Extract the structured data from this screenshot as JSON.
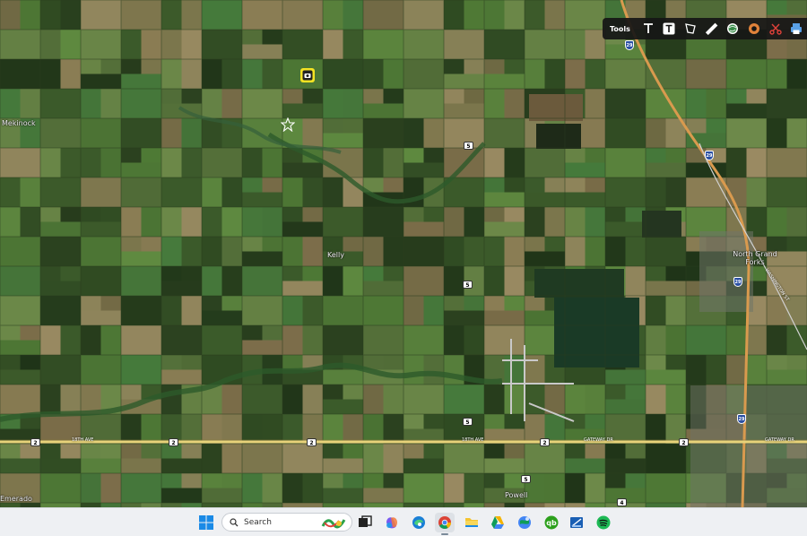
{
  "map": {
    "places": [
      "Mekinock",
      "Kelly",
      "North Grand Forks",
      "Emerado",
      "Powell"
    ],
    "road_labels": [
      "18TH AVE",
      "18TH AVE",
      "GATEWAY DR",
      "GATEWAY DR",
      "WASHINGTON ST"
    ],
    "shields": {
      "state": [
        "5",
        "5",
        "5",
        "5",
        "2",
        "2",
        "2",
        "2",
        "2"
      ],
      "interstate": [
        "29",
        "29",
        "29"
      ],
      "county": "4"
    }
  },
  "toolbar": {
    "label": "Tools",
    "tools": [
      "text-tool",
      "text-box-tool",
      "polygon-tool",
      "ruler-tool",
      "globe-tool",
      "circle-tool",
      "scissors-tool",
      "print-tool"
    ]
  },
  "taskbar": {
    "search_placeholder": "Search",
    "apps": [
      "start",
      "search",
      "task-view",
      "copilot",
      "edge",
      "chrome",
      "file-explorer",
      "google-drive",
      "google-earth",
      "quickbooks",
      "snipping-tool",
      "spotify"
    ]
  },
  "colors": {
    "field_dark": "#2f4a22",
    "field_green": "#4f7a36",
    "field_tan": "#8c7d55",
    "highway": "#d99a4e",
    "interstate_shield": "#2a4fa3"
  }
}
